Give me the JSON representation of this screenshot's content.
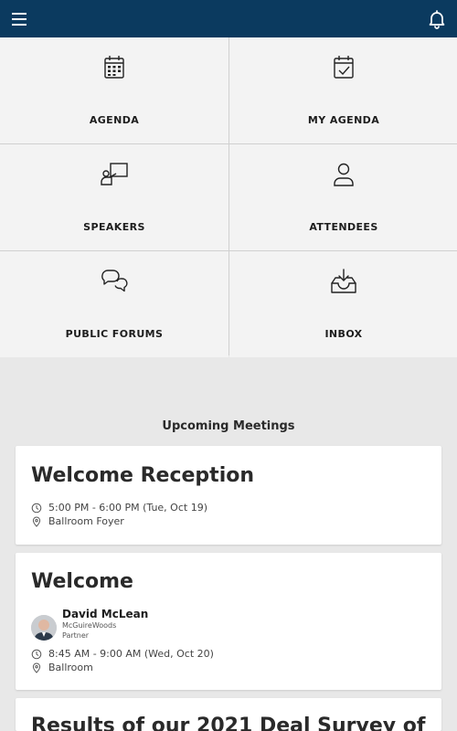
{
  "header": {
    "menu_icon": "hamburger-menu-icon",
    "notifications_icon": "bell-icon",
    "background": "#0b3a5f"
  },
  "tiles": [
    {
      "label": "AGENDA",
      "icon": "calendar-icon"
    },
    {
      "label": "MY AGENDA",
      "icon": "calendar-check-icon"
    },
    {
      "label": "SPEAKERS",
      "icon": "presenter-icon"
    },
    {
      "label": "ATTENDEES",
      "icon": "person-icon"
    },
    {
      "label": "PUBLIC FORUMS",
      "icon": "chat-bubbles-icon"
    },
    {
      "label": "INBOX",
      "icon": "inbox-download-icon"
    }
  ],
  "upcoming": {
    "title": "Upcoming Meetings",
    "meetings": [
      {
        "title": "Welcome Reception",
        "time": "5:00 PM - 6:00 PM (Tue, Oct 19)",
        "location": "Ballroom Foyer"
      },
      {
        "title": "Welcome",
        "speaker": {
          "name": "David McLean",
          "org": "McGuireWoods",
          "role": "Partner"
        },
        "time": "8:45 AM - 9:00 AM (Wed, Oct 20)",
        "location": "Ballroom"
      },
      {
        "title": "Results of our 2021 Deal Survey of"
      }
    ]
  }
}
